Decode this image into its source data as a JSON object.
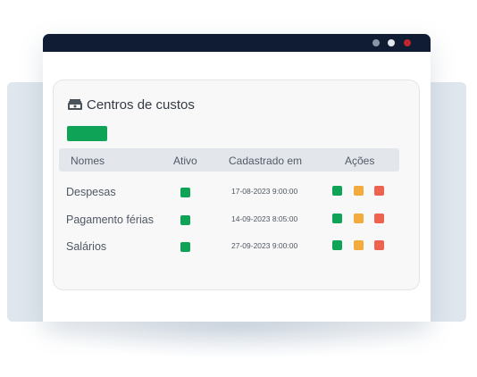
{
  "card": {
    "title": "Centros de custos",
    "title_icon": "cash-stack-icon"
  },
  "table": {
    "headers": [
      "Nomes",
      "Ativo",
      "Cadastrado em",
      "Ações"
    ],
    "rows": [
      {
        "name": "Despesas",
        "active": true,
        "date": "17-08-2023 9:00:00"
      },
      {
        "name": "Pagamento férias",
        "active": true,
        "date": "14-09-2023 8:05:00"
      },
      {
        "name": "Salários",
        "active": true,
        "date": "27-09-2023 9:00:00"
      }
    ]
  },
  "colors": {
    "titlebar": "#0f1c34",
    "primary_green": "#0fa358",
    "edit_orange": "#f2ab3c",
    "delete_red": "#ee6350",
    "close_dot": "#c0262d"
  }
}
